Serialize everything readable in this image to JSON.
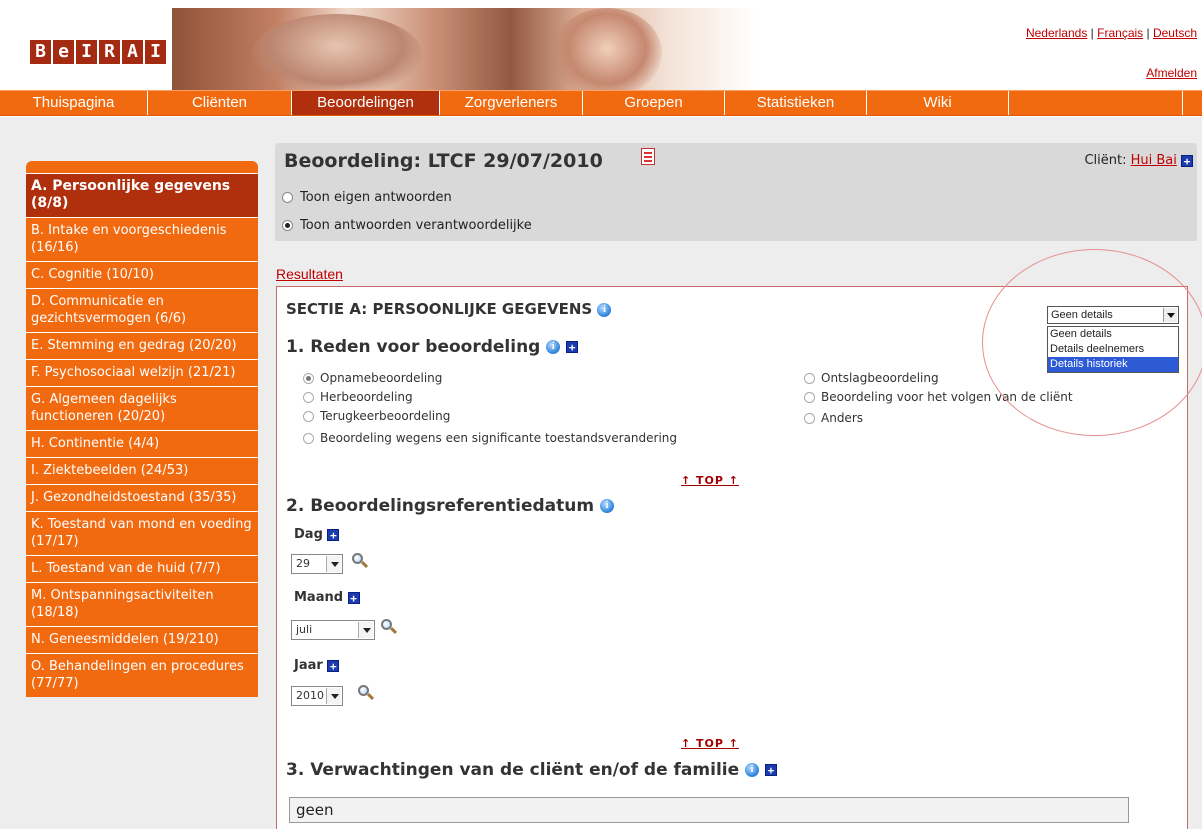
{
  "header": {
    "logo_letters": [
      "B",
      "e",
      "I",
      "R",
      "A",
      "I"
    ],
    "languages": [
      "Nederlands",
      "Français",
      "Deutsch"
    ],
    "language_separator": "|",
    "logout_label": "Afmelden"
  },
  "nav": {
    "tabs": [
      {
        "label": "Thuispagina",
        "active": false
      },
      {
        "label": "Cliënten",
        "active": false
      },
      {
        "label": "Beoordelingen",
        "active": true
      },
      {
        "label": "Zorgverleners",
        "active": false
      },
      {
        "label": "Groepen",
        "active": false
      },
      {
        "label": "Statistieken",
        "active": false
      },
      {
        "label": "Wiki",
        "active": false
      },
      {
        "label": "",
        "active": false
      }
    ]
  },
  "sidebar": {
    "items": [
      {
        "label": "A. Persoonlijke gegevens (8/8)",
        "active": true
      },
      {
        "label": "B. Intake en voorgeschiedenis (16/16)",
        "active": false
      },
      {
        "label": "C. Cognitie (10/10)",
        "active": false
      },
      {
        "label": "D. Communicatie en gezichtsvermogen (6/6)",
        "active": false
      },
      {
        "label": "E. Stemming en gedrag (20/20)",
        "active": false
      },
      {
        "label": "F. Psychosociaal welzijn (21/21)",
        "active": false
      },
      {
        "label": "G. Algemeen dagelijks functioneren (20/20)",
        "active": false
      },
      {
        "label": "H. Continentie (4/4)",
        "active": false
      },
      {
        "label": "I. Ziektebeelden (24/53)",
        "active": false
      },
      {
        "label": "J. Gezondheidstoestand (35/35)",
        "active": false
      },
      {
        "label": "K. Toestand van mond en voeding (17/17)",
        "active": false
      },
      {
        "label": "L. Toestand van de huid (7/7)",
        "active": false
      },
      {
        "label": "M. Ontspanningsactiviteiten (18/18)",
        "active": false
      },
      {
        "label": "N. Geneesmiddelen (19/210)",
        "active": false
      },
      {
        "label": "O. Behandelingen en procedures (77/77)",
        "active": false
      }
    ]
  },
  "assessment": {
    "title": "Beoordeling: LTCF 29/07/2010",
    "client_label": "Cliënt:",
    "client_name": "Hui Bai",
    "view_options": [
      {
        "label": "Toon eigen antwoorden",
        "selected": false
      },
      {
        "label": "Toon antwoorden verantwoordelijke",
        "selected": true
      }
    ],
    "results_link": "Resultaten"
  },
  "section": {
    "title": "SECTIE A: PERSOONLIJKE GEGEVENS",
    "details_select": {
      "value": "Geen details",
      "options": [
        "Geen details",
        "Details deelnemers",
        "Details historiek"
      ],
      "highlighted": "Details historiek"
    },
    "top_link": "↑ TOP ↑",
    "q1": {
      "title": "1. Reden voor beoordeling",
      "options_left": [
        {
          "label": "Opnamebeoordeling",
          "selected": true
        },
        {
          "label": "Herbeoordeling",
          "selected": false
        },
        {
          "label": "Terugkeerbeoordeling",
          "selected": false
        },
        {
          "label": "Beoordeling wegens een significante toestandsverandering",
          "selected": false
        }
      ],
      "options_right": [
        {
          "label": "Ontslagbeoordeling",
          "selected": false
        },
        {
          "label": "Beoordeling voor het volgen van de cliënt",
          "selected": false
        },
        {
          "label": "Anders",
          "selected": false
        }
      ]
    },
    "q2": {
      "title": "2. Beoordelingsreferentiedatum",
      "day_label": "Dag",
      "day_value": "29",
      "month_label": "Maand",
      "month_value": "juli",
      "year_label": "Jaar",
      "year_value": "2010"
    },
    "q3": {
      "title": "3. Verwachtingen van de cliënt en/of de familie",
      "value": "geen"
    }
  },
  "colors": {
    "accent": "#f26a10",
    "active": "#b0300e",
    "link": "#c00000"
  }
}
